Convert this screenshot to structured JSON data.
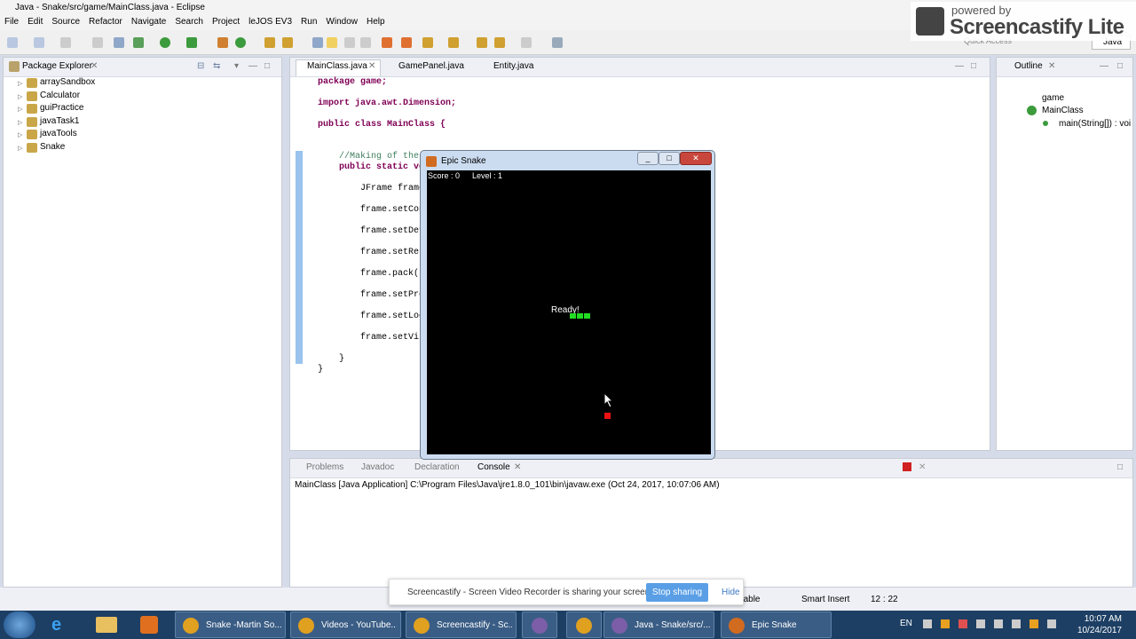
{
  "window": {
    "title": "Java - Snake/src/game/MainClass.java - Eclipse"
  },
  "menu": [
    "File",
    "Edit",
    "Source",
    "Refactor",
    "Navigate",
    "Search",
    "Project",
    "leJOS EV3",
    "Run",
    "Window",
    "Help"
  ],
  "screencastify_logo": {
    "line1": "powered by",
    "line2": "Screencastify Lite"
  },
  "quick_access": "Quick Access",
  "perspective": "Java",
  "package_explorer": {
    "tab": "Package Explorer",
    "projects": [
      "arraySandbox",
      "Calculator",
      "guiPractice",
      "javaTask1",
      "javaTools",
      "Snake"
    ]
  },
  "editor": {
    "tabs": [
      "MainClass.java",
      "GamePanel.java",
      "Entity.java"
    ],
    "lines": [
      "package game;",
      "import java.awt.Dimension;",
      "public class MainClass {",
      "    //Making of the i",
      "    public static voi",
      "        JFrame frame",
      "        frame.setCont",
      "        frame.setDefa",
      "        frame.setResi",
      "        frame.pack();",
      "        frame.setPref",
      "        frame.setLoca",
      "        frame.setVisi",
      "    }",
      "}"
    ]
  },
  "outline": {
    "tab": "Outline",
    "items": [
      "game",
      "MainClass",
      "main(String[]) : voi"
    ]
  },
  "bottom": {
    "tabs": [
      "Problems",
      "Javadoc",
      "Declaration",
      "Console"
    ],
    "console_line": "MainClass [Java Application] C:\\Program Files\\Java\\jre1.8.0_101\\bin\\javaw.exe (Oct 24, 2017, 10:07:06 AM)"
  },
  "status": {
    "writable": "Writable",
    "insert": "Smart Insert",
    "position": "12 : 22"
  },
  "share_bar": {
    "message": "Screencastify - Screen Video Recorder is sharing your screen.",
    "stop": "Stop sharing",
    "hide": "Hide"
  },
  "game_window": {
    "title": "Epic Snake",
    "score": "Score : 0",
    "level": "Level : 1",
    "ready": "Ready!",
    "snake_segments": 3,
    "colors": {
      "snake": "#22dd22",
      "food": "#ee1111",
      "background": "#000000"
    }
  },
  "taskbar": {
    "items": [
      {
        "label": "Snake -Martin So...",
        "color": "#e0a020"
      },
      {
        "label": "Videos - YouTube...",
        "color": "#e0a020"
      },
      {
        "label": "Screencastify - Sc...",
        "color": "#e0a020"
      },
      {
        "label": "",
        "color": "#7b5ea7"
      },
      {
        "label": "",
        "color": "#e0a020"
      },
      {
        "label": "Java - Snake/src/...",
        "color": "#7b5ea7"
      },
      {
        "label": "Epic Snake",
        "color": "#d06b20"
      }
    ],
    "lang": "EN",
    "time": "10:07 AM",
    "date": "10/24/2017"
  }
}
